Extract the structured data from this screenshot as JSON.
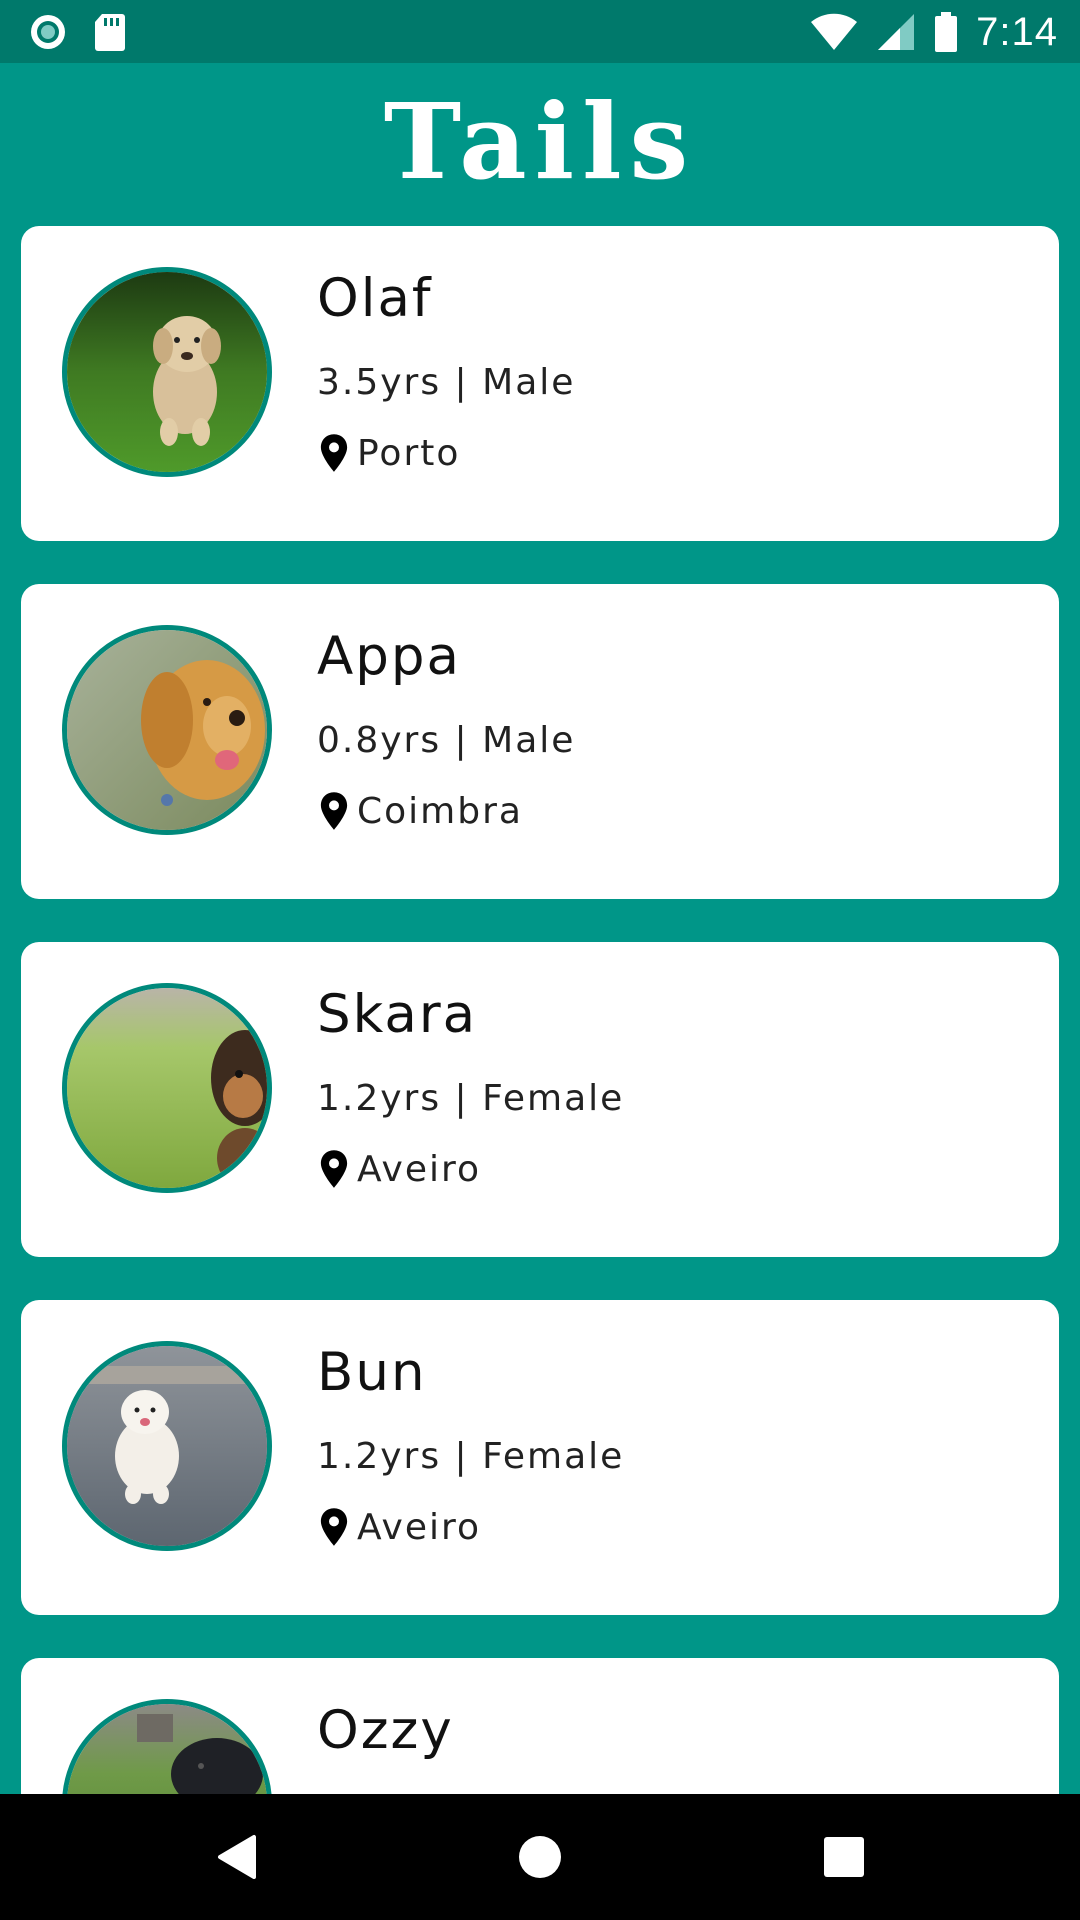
{
  "status_bar": {
    "time": "7:14",
    "left_icons": [
      "record-icon",
      "sd-card-icon"
    ],
    "right_icons": [
      "wifi-icon",
      "cell-signal-icon",
      "battery-icon"
    ]
  },
  "app": {
    "title": "Tails"
  },
  "pets": [
    {
      "name": "Olaf",
      "details": "3.5yrs | Male",
      "location": "Porto",
      "photo": "yellow-lab-puppy-on-grass"
    },
    {
      "name": "Appa",
      "details": "0.8yrs | Male",
      "location": "Coimbra",
      "photo": "golden-retriever-puppy"
    },
    {
      "name": "Skara",
      "details": "1.2yrs | Female",
      "location": "Aveiro",
      "photo": "german-shepherd-puppy-on-grass"
    },
    {
      "name": "Bun",
      "details": "1.2yrs | Female",
      "location": "Aveiro",
      "photo": "white-samoyed-puppy-on-pavement"
    },
    {
      "name": "Ozzy",
      "details": "",
      "location": "",
      "photo": "black-puppy-on-grass"
    }
  ],
  "nav": {
    "buttons": [
      "back-icon",
      "home-icon",
      "recents-icon"
    ]
  },
  "colors": {
    "primary": "#009688",
    "primary_dark": "#00796B",
    "avatar_border": "#00897B",
    "card": "#ffffff"
  }
}
